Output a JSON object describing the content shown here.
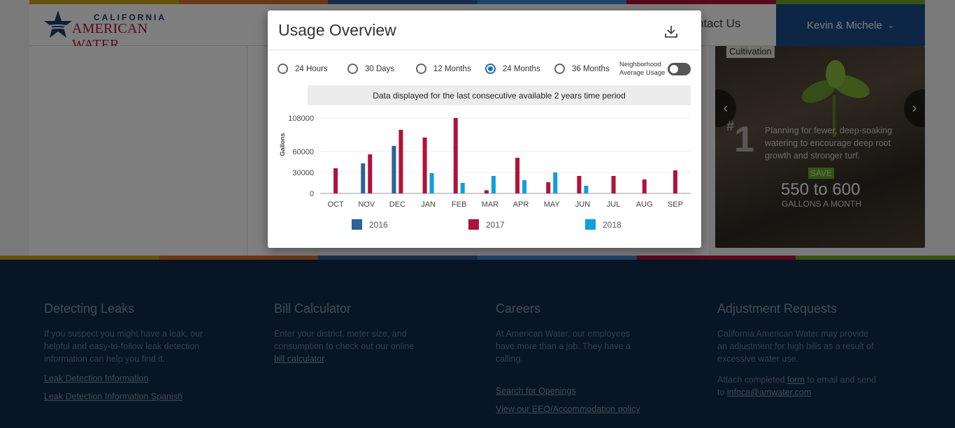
{
  "brand": {
    "line1": "CALIFORNIA",
    "line2": "AMERICAN WATER"
  },
  "nav": {
    "contact": "ntact Us",
    "user": "Kevin & Michele"
  },
  "colors": {
    "navy": "#1b3f73",
    "crimson": "#b0123b",
    "s2016": "#2b6298",
    "s2017": "#b0123b",
    "s2018": "#0e9fdc",
    "radio_active": "#1f6fb4"
  },
  "stripe_colors": [
    "#c8a218",
    "#d9702a",
    "#2f5d9a",
    "#3b8fd0",
    "#b0123b",
    "#6aa827"
  ],
  "promo": {
    "tag": "Cultivation",
    "rank": "1",
    "text": "Planning for fewer, deep-soaking watering to encourage deep root growth and stronger turf.",
    "save_label": "SAVE",
    "amount": "550 to 600",
    "unit": "GALLONS A MONTH"
  },
  "modal": {
    "title": "Usage Overview",
    "download_icon": "download-icon",
    "ranges": [
      "24 Hours",
      "30 Days",
      "12 Months",
      "24 Months",
      "36 Months"
    ],
    "selected_range": "24 Months",
    "neighborhood_label_1": "Neighborhood",
    "neighborhood_label_2": "Average Usage",
    "neighborhood_on": false,
    "info": "Data displayed for the last consecutive available 2 years time period"
  },
  "chart_data": {
    "type": "bar",
    "ylabel": "Gallons",
    "yticks": [
      0,
      30000,
      60000,
      108000
    ],
    "ylim": [
      0,
      110000
    ],
    "categories": [
      "OCT",
      "NOV",
      "DEC",
      "JAN",
      "FEB",
      "MAR",
      "APR",
      "MAY",
      "JUN",
      "JUL",
      "AUG",
      "SEP"
    ],
    "series": [
      {
        "name": "2016",
        "color": "#2b6298",
        "values": [
          0,
          43000,
          68000,
          0,
          0,
          0,
          0,
          0,
          0,
          0,
          0,
          0
        ]
      },
      {
        "name": "2017",
        "color": "#b0123b",
        "values": [
          36000,
          56000,
          91000,
          80000,
          108000,
          4500,
          51000,
          16000,
          25000,
          25000,
          20000,
          33000
        ]
      },
      {
        "name": "2018",
        "color": "#0e9fdc",
        "values": [
          0,
          0,
          0,
          29000,
          15000,
          25000,
          19000,
          30000,
          11000,
          0,
          0,
          0
        ]
      }
    ],
    "legend": "bottom",
    "grid": true
  },
  "footer": {
    "col1": {
      "title": "Detecting Leaks",
      "body": "If you suspect you might have a leak, our helpful and easy-to-follow leak detection information can help you find it.",
      "link1": "Leak Detection Information",
      "link2": "Leak Detection Information Spanish"
    },
    "col2": {
      "title": "Bill Calculator",
      "body_pre": "Enter your district, meter size, and consumption to check out our online ",
      "link": "bill calculator",
      "body_post": "."
    },
    "col3": {
      "title": "Careers",
      "body": "At American Water, our employees have more than a job. They have a calling.",
      "link1": "Search for Openings",
      "link2": "View our EEO/Accommodation policy"
    },
    "col4": {
      "title": "Adjustment Requests",
      "body": "California American Water may provide an adjustment for high bills as a result of excessive water use.",
      "body2_pre": "Attach completed ",
      "body2_link": "form",
      "body2_mid": " to email and send to ",
      "body2_email": "infoca@amwater.com"
    }
  }
}
